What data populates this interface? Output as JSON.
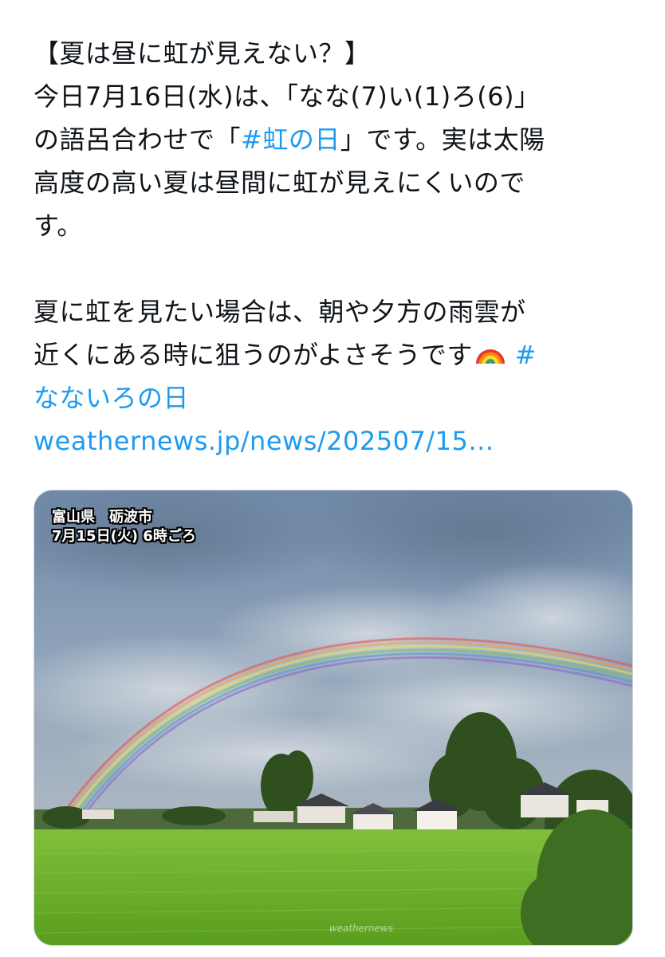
{
  "tweet": {
    "lines": [
      "【夏は昼に虹が見えない？】",
      "今日7月16日(水)は、「なな(7)い(1)ろ(6)」",
      "の語呂合わせで「",
      "」です。実は太陽",
      "高度の高い夏は昼間に虹が見えにくいので",
      "す。",
      "夏に虹を見たい場合は、朝や夕方の雨雲が",
      "近くにある時に狙うのがよさそうです"
    ],
    "hashtag_niji": "#虹の日",
    "hashtag_nanairo_part1": "#",
    "hashtag_nanairo_part2": "なないろの日",
    "link": "weathernews.jp/news/202507/15…",
    "emoji": "rainbow"
  },
  "media": {
    "caption_line1": "富山県　砺波市",
    "caption_line2": "7月15日(火) 6時ごろ",
    "watermark": "weathernews"
  },
  "colors": {
    "text": "#0f1419",
    "link": "#1d9bf0",
    "border": "#cfd9de"
  }
}
